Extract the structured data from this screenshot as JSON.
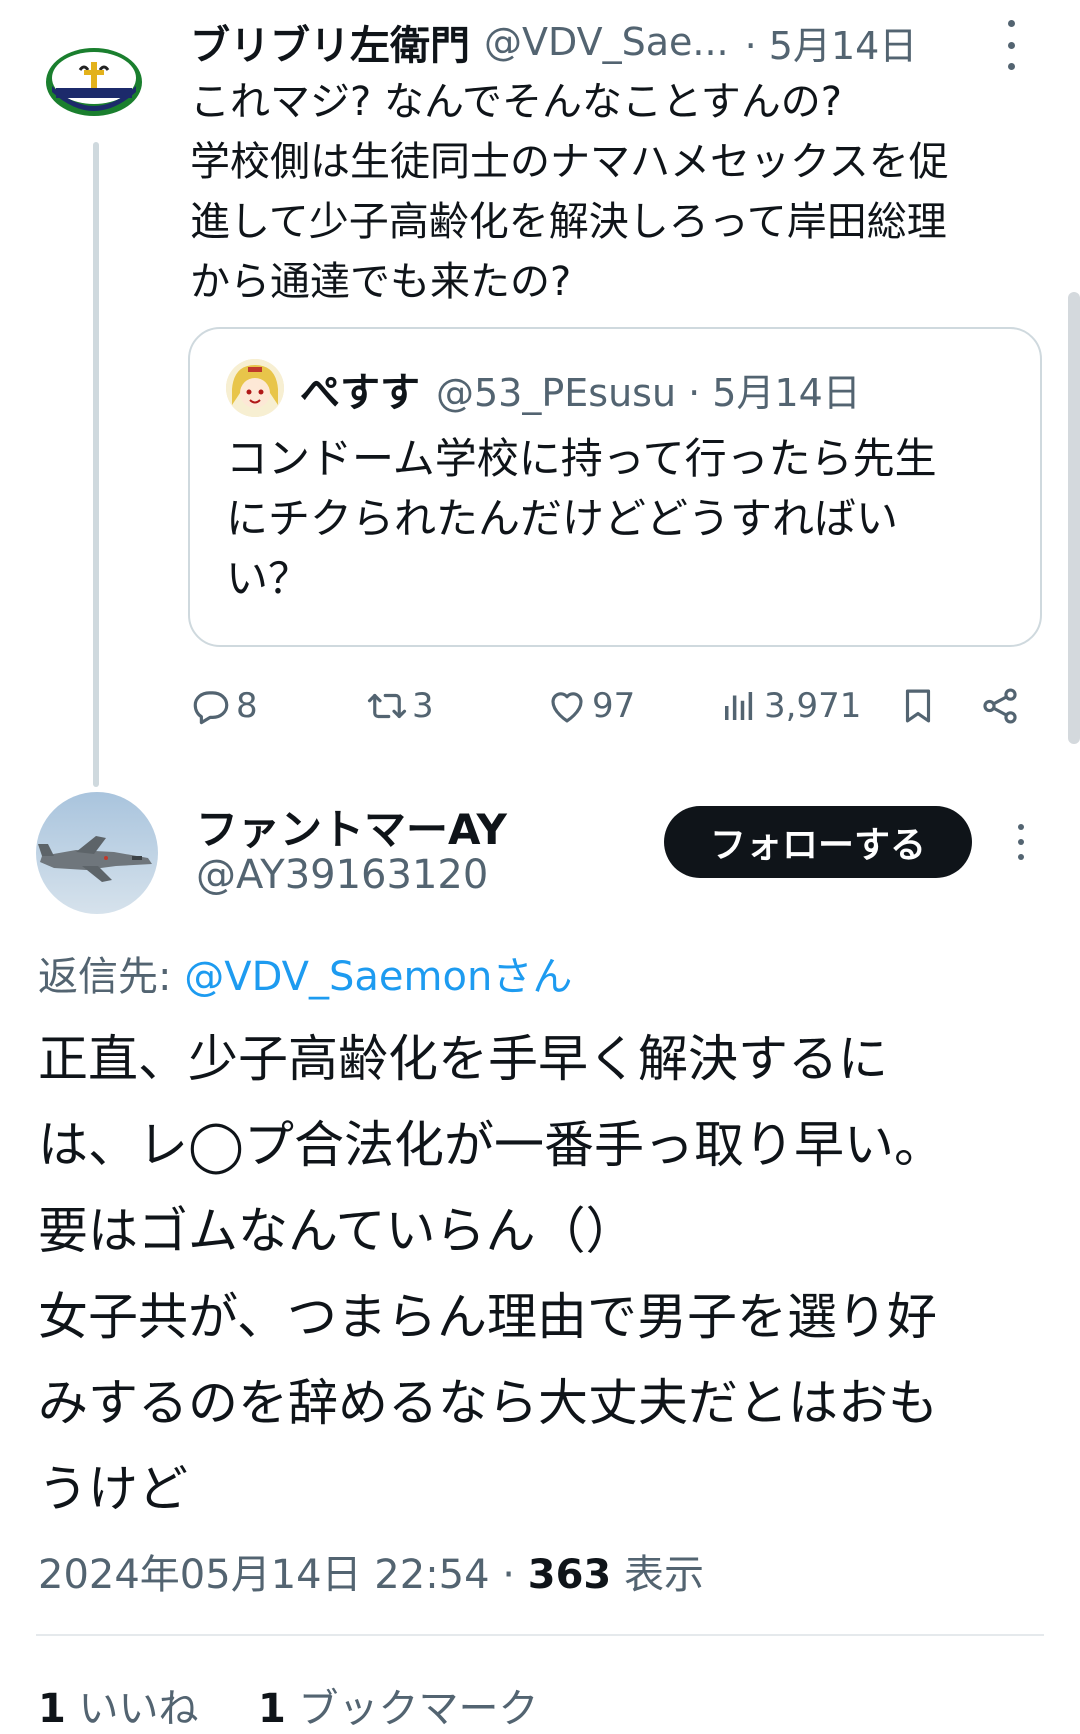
{
  "parent_tweet": {
    "name": "ブリブリ左衛門",
    "handle": "@VDV_Sae...",
    "date": "· 5月14日",
    "text_lines": [
      "これマジ? なんでそんなことすんの?",
      "学校側は生徒同士のナマハメセックスを促",
      "進して少子高齢化を解決しろって岸田総理",
      "から通達でも来たの?"
    ],
    "quote": {
      "name": "ぺすす",
      "handle": "@53_PEsusu · 5月14日",
      "text_lines": [
        "コンドーム学校に持って行ったら先生",
        "にチクられたんだけどどうすればい",
        "い？"
      ]
    },
    "actions": {
      "replies": "8",
      "retweets": "3",
      "likes": "97",
      "views": "3,971"
    }
  },
  "main_tweet": {
    "name": "ファントマーAY",
    "handle": "@AY39163120",
    "follow_label": "フォローする",
    "reply_prefix": "返信先: ",
    "reply_handle": "@VDV_Saemonさん",
    "text_lines": [
      "正直、少子高齢化を手早く解決するに",
      "は、レ◯プ合法化が一番手っ取り早い。",
      "要はゴムなんていらん（）",
      "女子共が、つまらん理由で男子を選り好",
      "みするのを辞めるなら大丈夫だとはおも",
      "うけど"
    ],
    "timestamp": "2024年05月14日 22:54 · ",
    "view_count": "363",
    "view_label": " 表示",
    "likes_count": "1",
    "likes_label": " いいね",
    "bookmarks_count": "1",
    "bookmarks_label": " ブックマーク"
  },
  "colors": {
    "text": "#0f1419",
    "muted": "#536471",
    "link": "#1d9bf0",
    "border": "#cfd9de",
    "follow_bg": "#0f1419"
  },
  "icons": [
    "reply-icon",
    "retweet-icon",
    "like-icon",
    "views-icon",
    "bookmark-icon",
    "share-icon",
    "more-icon"
  ]
}
